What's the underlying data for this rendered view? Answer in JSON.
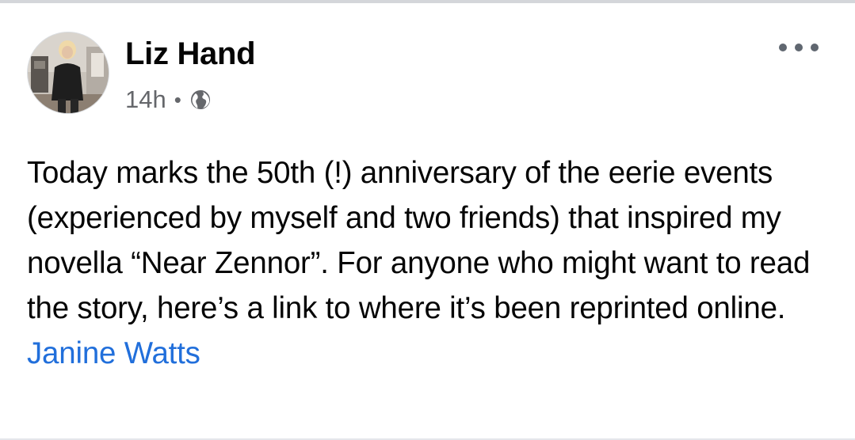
{
  "post": {
    "author": {
      "name": "Liz Hand",
      "avatar_icon": "profile-photo"
    },
    "timestamp": "14h",
    "separator": "•",
    "privacy_icon": "globe-icon",
    "more_icon": "more-options-icon",
    "body_text": "Today marks the 50th (!) anniversary of the eerie events (experienced by myself and two friends) that inspired my novella “Near Zennor”.  For anyone who might want to read the story, here’s a link to where it’s been reprinted online. ",
    "mention": "Janine Watts"
  },
  "colors": {
    "text_primary": "#050505",
    "text_secondary": "#65676b",
    "link": "#216fdb",
    "divider": "#d4d6da"
  }
}
